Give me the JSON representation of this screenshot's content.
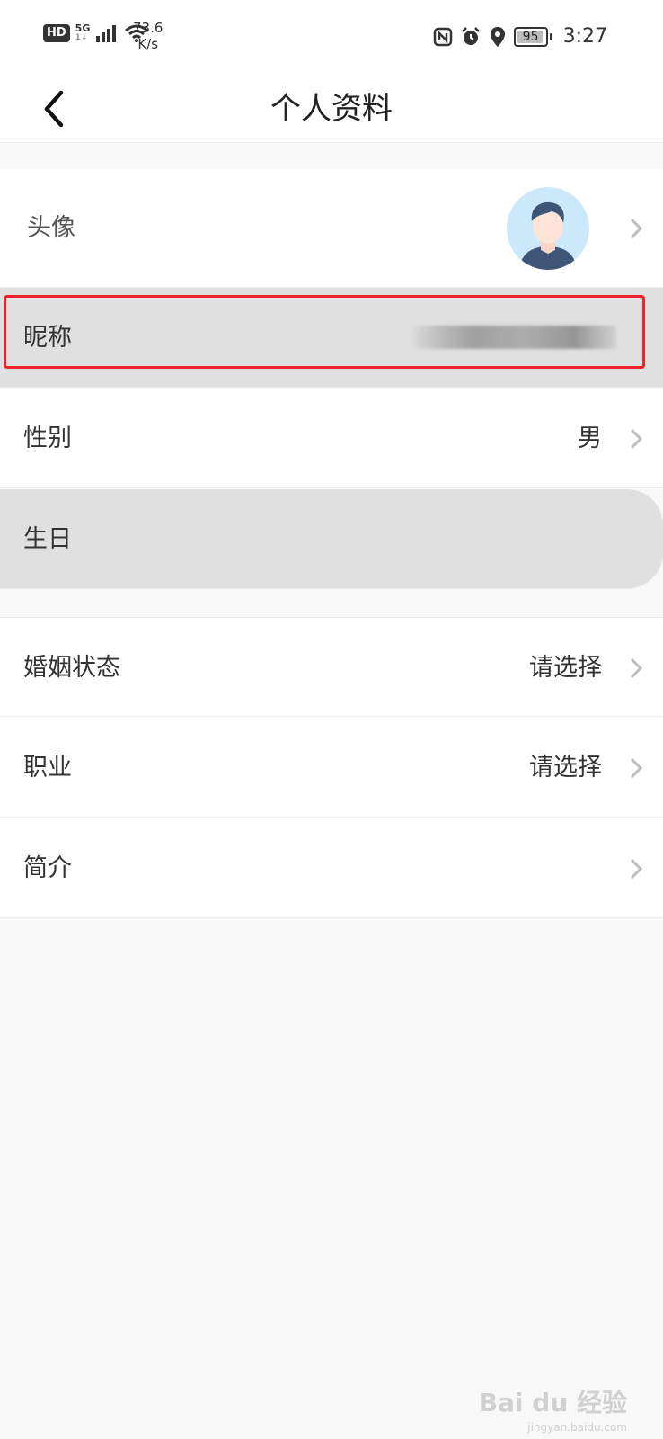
{
  "status_bar": {
    "hd": "HD",
    "network": "5G",
    "signal_sub": "1↓",
    "speed_value": "73.6",
    "speed_unit": "K/s",
    "battery": "95",
    "battery_level": 0.95,
    "time": "3:27",
    "icons": [
      "nfc-icon",
      "alarm-icon",
      "location-icon"
    ]
  },
  "header": {
    "title": "个人资料"
  },
  "rows": {
    "avatar": {
      "label": "头像"
    },
    "nickname": {
      "label": "昵称"
    },
    "gender": {
      "label": "性别",
      "value": "男"
    },
    "birthday": {
      "label": "生日"
    },
    "marital": {
      "label": "婚姻状态",
      "value": "请选择"
    },
    "job": {
      "label": "职业",
      "value": "请选择"
    },
    "bio": {
      "label": "简介"
    }
  },
  "watermark": {
    "brand": "Bai du 经验",
    "url": "jingyan.baidu.com"
  },
  "colors": {
    "highlight": "#f0232a",
    "pressed": "#e0e0e0",
    "avatar_bg": "#cbe9fa"
  }
}
